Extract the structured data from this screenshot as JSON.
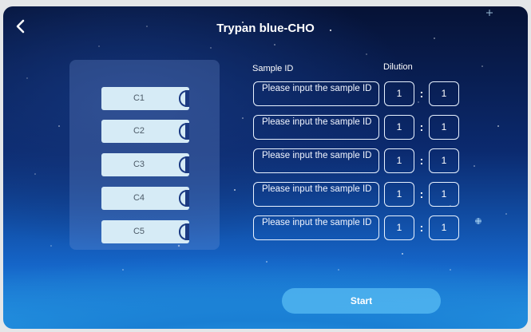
{
  "header": {
    "title": "Trypan blue-CHO",
    "back_icon": "chevron-left-icon"
  },
  "columns": {
    "sample_id": "Sample ID",
    "dilution": "Dilution"
  },
  "channels": [
    {
      "label": "C1",
      "sample_placeholder": "Please input the sample ID",
      "dilution_left": "1",
      "dilution_right": "1"
    },
    {
      "label": "C2",
      "sample_placeholder": "Please input the sample ID",
      "dilution_left": "1",
      "dilution_right": "1"
    },
    {
      "label": "C3",
      "sample_placeholder": "Please input the sample ID",
      "dilution_left": "1",
      "dilution_right": "1"
    },
    {
      "label": "C4",
      "sample_placeholder": "Please input the sample ID",
      "dilution_left": "1",
      "dilution_right": "1"
    },
    {
      "label": "C5",
      "sample_placeholder": "Please input the sample ID",
      "dilution_left": "1",
      "dilution_right": "1"
    }
  ],
  "dilution_separator": ":",
  "actions": {
    "start_label": "Start"
  },
  "colors": {
    "background_top": "#061235",
    "background_bottom": "#2aa2ea",
    "channel_fill": "#d6ebf6",
    "channel_tab": "#1b3a82"
  }
}
